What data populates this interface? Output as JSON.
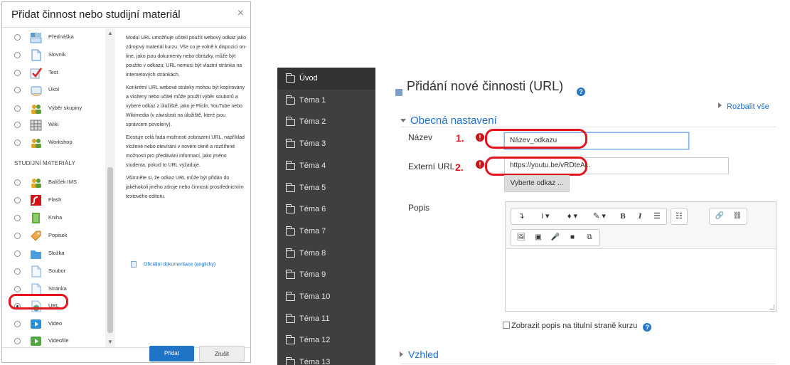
{
  "dialog": {
    "title": "Přidat činnost nebo studijní materiál",
    "close": "×",
    "activities": [
      {
        "label": "Přednáška",
        "icon": "lecture-icon",
        "color": "#5a9bd5"
      },
      {
        "label": "Slovník",
        "icon": "glossary-icon",
        "color": "#6aa0d8"
      },
      {
        "label": "Test",
        "icon": "quiz-icon",
        "color": "#d42f2f"
      },
      {
        "label": "Úkol",
        "icon": "assignment-icon",
        "color": "#5f9ad6"
      },
      {
        "label": "Výběr skupiny",
        "icon": "group-choice-icon",
        "color": "#e9a12a"
      },
      {
        "label": "Wiki",
        "icon": "wiki-icon",
        "color": "#707070"
      },
      {
        "label": "Workshop",
        "icon": "workshop-icon",
        "color": "#e2a22c"
      }
    ],
    "section_label": "STUDIJNÍ MATERIÁLY",
    "resources": [
      {
        "label": "Balíček IMS",
        "icon": "ims-package-icon",
        "color": "#f0a51e"
      },
      {
        "label": "Flash",
        "icon": "flash-icon",
        "color": "#d4121a"
      },
      {
        "label": "Kniha",
        "icon": "book-icon",
        "color": "#5cae36"
      },
      {
        "label": "Popisek",
        "icon": "label-icon",
        "color": "#f2a94c"
      },
      {
        "label": "Složka",
        "icon": "folder-icon",
        "color": "#4a9ede"
      },
      {
        "label": "Soubor",
        "icon": "file-icon",
        "color": "#8fb7e4"
      },
      {
        "label": "Stránka",
        "icon": "page-icon",
        "color": "#8fb7e4"
      },
      {
        "label": "URL",
        "icon": "url-icon",
        "color": "#6aa3dc",
        "selected": true
      },
      {
        "label": "Video",
        "icon": "video-icon",
        "color": "#2a8fd8"
      },
      {
        "label": "Videofile",
        "icon": "videofile-icon",
        "color": "#54a842"
      }
    ],
    "description": [
      "Modul URL umožňuje učiteli použít webový odkaz jako zdrojový materiál kurzu. Vše co je volně k dispozici on-line, jako jsou dokumenty nebo obrázky, může být použito v odkazu; URL nemusí být vlastní stránka na internetových stránkách.",
      "Konkrétní URL webové stránky mohou být kopírovány a vloženy nebo učitel může použít výběr souborů a vybere odkaz z úložiště, jako je Flickr, YouTube nebo Wikimedia (v závislosti na úložiště, které jsou správcem povoleny).",
      "Existuje celá řada možností zobrazení URL, například vložené nebo otevírání v novém okně a rozšířené možnosti pro předávání informací, jako jméno studenta, pokud to URL vyžaduje.",
      "Všimněte si, že odkaz URL může být přidán do jakéhokoli jiného zdroje nebo činnosti prostřednictvím textového editoru."
    ],
    "doc_link": "Oficiální dokumentace (anglicky)",
    "add_button": "Přidat",
    "cancel_button": "Zrušit"
  },
  "nav": {
    "items": [
      "Úvod",
      "Téma 1",
      "Téma 2",
      "Téma 3",
      "Téma 4",
      "Téma 5",
      "Téma 6",
      "Téma 7",
      "Téma 8",
      "Téma 9",
      "Téma 10",
      "Téma 11",
      "Téma 12",
      "Téma 13"
    ],
    "active": "Úvod"
  },
  "page": {
    "title": "Přidání nové činnosti (URL)",
    "expand_all": "Rozbalit vše",
    "section_general": "Obecná nastavení",
    "section_look": "Vzhled",
    "name_label": "Název",
    "name_value": "Název_odkazu",
    "url_label": "Externí URL",
    "url_value": "https://youtu.be/vRDteA...",
    "select_link_button": "Vyberte odkaz ...",
    "description_label": "Popis",
    "show_description": "Zobrazit popis na titulní straně kurzu",
    "marker1": "1.",
    "marker2": "2.",
    "required": "!",
    "help": "?"
  },
  "editor": {
    "toolbar_row1": [
      "↴",
      "i ▾",
      "♦ ▾",
      "✎ ▾",
      "B",
      "I",
      "☰",
      "☷",
      "🔗",
      "⛓"
    ],
    "toolbar_row2": [
      "🖼",
      "▣",
      "🎤",
      "■",
      "⧉"
    ]
  },
  "colors": {
    "accent": "#1a6fd0",
    "nav_bg": "#3f3f3f",
    "annotation_red": "#e3141e",
    "required_red": "#c8141c",
    "primary_button": "#1f74c8"
  }
}
